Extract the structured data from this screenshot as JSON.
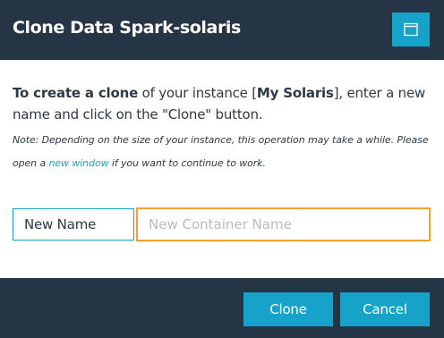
{
  "dialog": {
    "title": "Clone Data Spark-solaris",
    "maximize_icon": "window-maximize-icon"
  },
  "intro": {
    "lead_bold": "To create a clone",
    "part1": " of your instance [",
    "instance_name": "My Solaris",
    "part2": "], enter a new name and click on the \"Clone\" button."
  },
  "note": {
    "part1": "Note: Depending on the size of your instance, this operation may take a while. Please open a ",
    "link": "new window",
    "part2": " if you want to continue to work."
  },
  "form": {
    "label": "New Name",
    "placeholder": "New Container Name",
    "value": ""
  },
  "footer": {
    "clone_label": "Clone",
    "cancel_label": "Cancel"
  },
  "colors": {
    "header_bg": "#263545",
    "accent": "#17a2c9",
    "focus_border": "#f0a230"
  }
}
